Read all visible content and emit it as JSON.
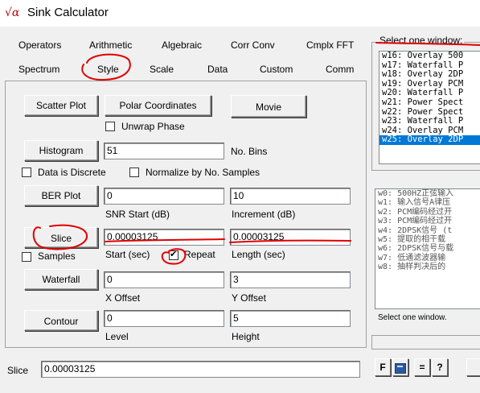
{
  "window": {
    "title": "Sink Calculator",
    "icon_glyph": "√α"
  },
  "tabs_row1": [
    {
      "label": "Operators"
    },
    {
      "label": "Arithmetic"
    },
    {
      "label": "Algebraic"
    },
    {
      "label": "Corr Conv"
    },
    {
      "label": "Cmplx FFT"
    }
  ],
  "tabs_row2": [
    {
      "label": "Spectrum"
    },
    {
      "label": "Style"
    },
    {
      "label": "Scale"
    },
    {
      "label": "Data"
    },
    {
      "label": "Custom"
    },
    {
      "label": "Comm"
    }
  ],
  "style_panel": {
    "scatter_plot": "Scatter Plot",
    "polar_coordinates": "Polar Coordinates",
    "movie": "Movie",
    "unwrap_phase": "Unwrap Phase",
    "histogram": "Histogram",
    "histogram_value": "51",
    "no_bins": "No. Bins",
    "data_discrete": "Data is Discrete",
    "normalize": "Normalize by No. Samples",
    "ber_plot": "BER Plot",
    "snr_start_value": "0",
    "snr_start_label": "SNR Start (dB)",
    "increment_value": "10",
    "increment_label": "Increment (dB)",
    "slice": "Slice",
    "samples": "Samples",
    "start_value": "0.00003125",
    "start_label": "Start (sec)",
    "repeat": "Repeat",
    "length_value": "0.00003125",
    "length_label": "Length (sec)",
    "waterfall": "Waterfall",
    "x_offset_value": "0",
    "x_offset_label": "X Offset",
    "y_offset_value": "3",
    "y_offset_label": "Y Offset",
    "contour": "Contour",
    "level_value": "0",
    "level_label": "Level",
    "height_value": "5",
    "height_label": "Height"
  },
  "select_window": {
    "title": "Select one window:",
    "items": [
      "w16: Overlay 500",
      "w17: Waterfall P",
      "w18: Overlay 2DP",
      "w19: Overlay PCM",
      "w20: Waterfall P",
      "w21: Power Spect",
      "w22: Power Spect",
      "w23: Waterfall P",
      "w24: Overlay PCM",
      "w25: Overlay 2DP"
    ]
  },
  "descriptions": {
    "items": [
      "w0: 500HZ正弦输入",
      "w1: 输入信号A律压",
      "w2: PCM编码经过开",
      "w3: PCM编码经过开",
      "w4: 2DPSK信号 (t",
      "w5: 提取的相干载",
      "w6: 2DPSK信号与载",
      "w7: 低通滤波器输",
      "w8: 抽样判决后的"
    ],
    "caption": "Select one window."
  },
  "status": {
    "label": "Slice",
    "value": "0.00003125",
    "btn_f": "F",
    "btn_eq": "=",
    "btn_q": "?"
  },
  "colors": {
    "annotation": "#e00000",
    "selection": "#0078d7"
  }
}
